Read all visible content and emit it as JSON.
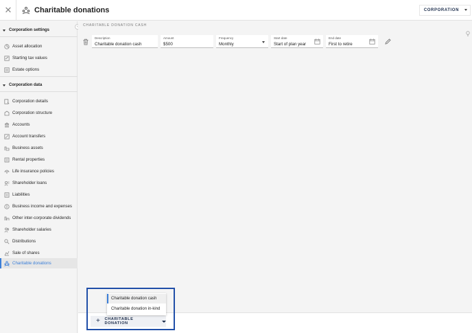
{
  "header": {
    "title": "Charitable donations",
    "close_icon": "close-icon",
    "title_icon": "donation-icon",
    "entity_button": "CORPORATION"
  },
  "sidebar": {
    "sections": [
      {
        "label": "Corporation settings",
        "items": [
          {
            "label": "Asset allocation",
            "icon": "pie-icon"
          },
          {
            "label": "Starting tax values",
            "icon": "tax-icon"
          },
          {
            "label": "Estate options",
            "icon": "estate-icon"
          }
        ]
      },
      {
        "label": "Corporation data",
        "items": [
          {
            "label": "Corporation details",
            "icon": "details-icon"
          },
          {
            "label": "Corporation structure",
            "icon": "structure-icon"
          },
          {
            "label": "Accounts",
            "icon": "accounts-icon"
          },
          {
            "label": "Account transfers",
            "icon": "transfers-icon"
          },
          {
            "label": "Business assets",
            "icon": "business-icon"
          },
          {
            "label": "Rental properties",
            "icon": "rental-icon"
          },
          {
            "label": "Life insurance policies",
            "icon": "insurance-icon"
          },
          {
            "label": "Shareholder loans",
            "icon": "loans-icon"
          },
          {
            "label": "Liabilities",
            "icon": "liabilities-icon"
          },
          {
            "label": "Business income and expenses",
            "icon": "income-icon"
          },
          {
            "label": "Other inter-corporate dividends",
            "icon": "dividends-icon"
          },
          {
            "label": "Shareholder salaries",
            "icon": "salaries-icon"
          },
          {
            "label": "Distributions",
            "icon": "distributions-icon"
          },
          {
            "label": "Sale of shares",
            "icon": "shares-icon"
          },
          {
            "label": "Charitable donations",
            "icon": "donation-icon",
            "active": true
          }
        ]
      }
    ]
  },
  "main": {
    "section_label": "CHARITABLE DONATION CASH",
    "fields": {
      "description": {
        "label": "Description",
        "value": "Charitable donation cash"
      },
      "amount": {
        "label": "Amount",
        "value": "$500"
      },
      "frequency": {
        "label": "Frequency",
        "value": "Monthly"
      },
      "start_date": {
        "label": "Start date",
        "value": "Start of plan year"
      },
      "end_date": {
        "label": "End date",
        "value": "First to retire"
      }
    }
  },
  "add_button": {
    "label": "CHARITABLE DONATION"
  },
  "menu": {
    "items": [
      "Charitable donation cash",
      "Charitable donation in-kind"
    ]
  },
  "colors": {
    "accent": "#3a7ed8",
    "highlight": "#1f4ea8",
    "navy": "#1a2b4a"
  }
}
